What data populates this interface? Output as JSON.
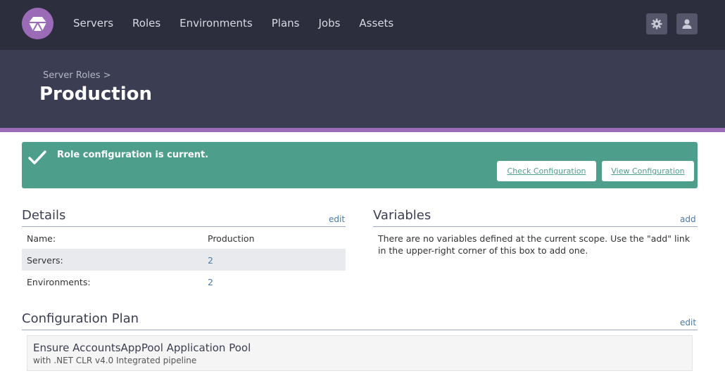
{
  "nav": {
    "items": [
      "Servers",
      "Roles",
      "Environments",
      "Plans",
      "Jobs",
      "Assets"
    ],
    "settings_icon": "gear-icon",
    "user_icon": "user-icon"
  },
  "header": {
    "breadcrumb": "Server Roles >",
    "title": "Production"
  },
  "alert": {
    "message": "Role configuration is current.",
    "check_button": "Check Configuration",
    "view_button": "View Configuration"
  },
  "details": {
    "title": "Details",
    "edit_label": "edit",
    "rows": [
      {
        "label": "Name:",
        "value": "Production"
      },
      {
        "label": "Servers:",
        "value": "2"
      },
      {
        "label": "Environments:",
        "value": "2"
      }
    ]
  },
  "variables": {
    "title": "Variables",
    "add_label": "add",
    "empty_text": "There are no variables defined at the current scope. Use the \"add\" link in the upper-right corner of this box to add one."
  },
  "plan": {
    "title": "Configuration Plan",
    "edit_label": "edit",
    "item_title": "Ensure AccountsAppPool Application Pool",
    "item_subtitle": "with .NET CLR v4.0 Integrated pipeline"
  },
  "colors": {
    "topbar": "#2c2d3d",
    "header": "#3b3d52",
    "accent": "#9b6bb8",
    "success": "#4d9e8b",
    "link": "#4a79a8"
  }
}
